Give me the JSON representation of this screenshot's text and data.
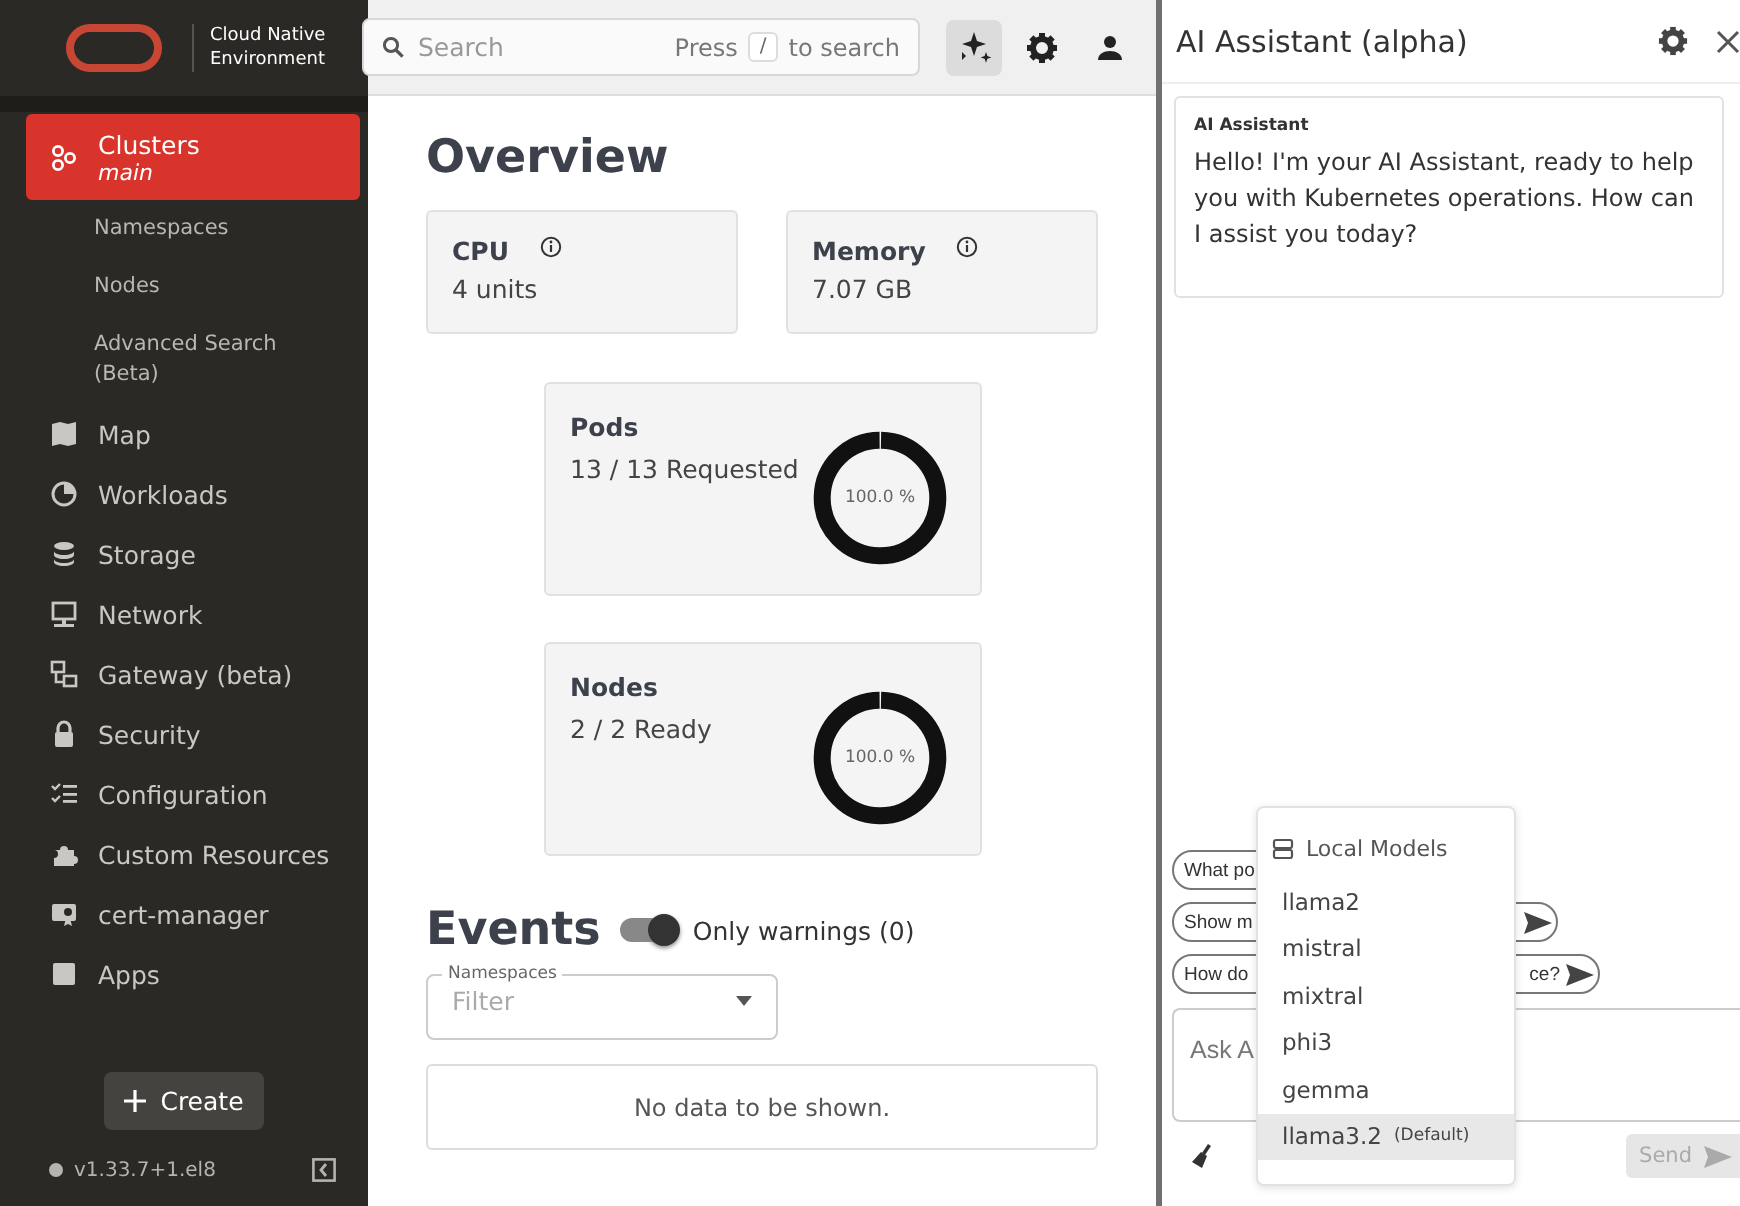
{
  "brand": {
    "lines": [
      "Cloud Native",
      "Environment"
    ]
  },
  "nav": [
    {
      "label": "Clusters",
      "sublabel": "main",
      "selected": true,
      "children": [
        {
          "label": "Namespaces"
        },
        {
          "label": "Nodes"
        },
        {
          "label": "Advanced Search (Beta)"
        }
      ]
    },
    {
      "label": "Map",
      "selected": false
    },
    {
      "label": "Workloads",
      "selected": false
    },
    {
      "label": "Storage",
      "selected": false
    },
    {
      "label": "Network",
      "selected": false
    },
    {
      "label": "Gateway (beta)",
      "selected": false
    },
    {
      "label": "Security",
      "selected": false
    },
    {
      "label": "Configuration",
      "selected": false
    },
    {
      "label": "Custom Resources",
      "selected": false
    },
    {
      "label": "cert-manager",
      "selected": false
    },
    {
      "label": "Apps",
      "selected": false
    }
  ],
  "create_button": "Create",
  "version": "v1.33.7+1.el8",
  "search": {
    "placeholder": "Search",
    "hint_before": "Press",
    "key": "/",
    "hint_after": "to search"
  },
  "toolbar": [
    {
      "selected": true
    },
    {
      "selected": false
    },
    {
      "selected": false
    }
  ],
  "overview": {
    "title": "Overview",
    "stats": [
      {
        "title": "CPU",
        "value": "4 units"
      },
      {
        "title": "Memory",
        "value": "7.07 GB"
      }
    ],
    "gauges": [
      {
        "title": "Pods",
        "value": "13 / 13 Requested",
        "label": "100.0 %"
      },
      {
        "title": "Nodes",
        "value": "2 / 2 Ready",
        "label": "100.0 %"
      }
    ]
  },
  "events": {
    "title": "Events",
    "toggle": {
      "label": "Only warnings (0)",
      "on": true
    },
    "filter": {
      "label": "Namespaces",
      "placeholder": "Filter"
    },
    "empty": "No data to be shown."
  },
  "assistant": {
    "title": "AI Assistant (alpha)",
    "message": {
      "author": "AI Assistant",
      "text": "Hello! I'm your AI Assistant, ready to help you with Kubernetes operations. How can I assist you today?"
    },
    "suggestions": [
      {
        "start": "What po"
      },
      {
        "start": "Show m",
        "arrow": true
      },
      {
        "start": "How do",
        "end": "ce?",
        "arrow": true
      }
    ],
    "input": {
      "placeholder": "Ask A"
    },
    "send": {
      "label": "Send",
      "disabled": true
    },
    "model_menu": {
      "header": "Local Models",
      "items": [
        {
          "name": "llama2",
          "selected": false
        },
        {
          "name": "mistral",
          "selected": false
        },
        {
          "name": "mixtral",
          "selected": false
        },
        {
          "name": "phi3",
          "selected": false
        },
        {
          "name": "gemma",
          "selected": false
        },
        {
          "name": "llama3.2",
          "note": "(Default)",
          "selected": true
        }
      ]
    }
  }
}
